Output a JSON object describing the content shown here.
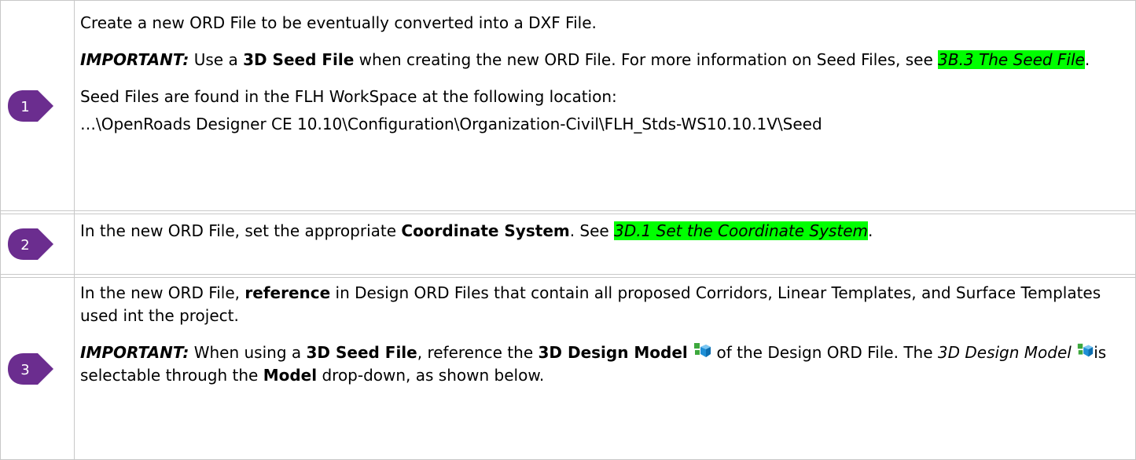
{
  "steps": [
    {
      "number": "1",
      "line1": "Create a new ORD File to be eventually converted into a DXF File.",
      "important_label": "IMPORTANT:",
      "important_pre": " Use a ",
      "important_bold": "3D Seed File",
      "important_mid": " when creating the new ORD File.  For more information on Seed Files, see ",
      "important_link": "3B.3 The Seed File",
      "important_post": ".",
      "location_intro": "Seed Files are found in the FLH WorkSpace at the following location:",
      "location_path": "…\\OpenRoads Designer CE 10.10\\Configuration\\Organization-Civil\\FLH_Stds-WS10.10.1V\\Seed"
    },
    {
      "number": "2",
      "pre": "In the new ORD File, set the appropriate ",
      "bold": "Coordinate System",
      "mid": ".  See ",
      "link": "3D.1 Set the Coordinate System",
      "post": "."
    },
    {
      "number": "3",
      "pre": "In the new ORD File, ",
      "bold": "reference",
      "post": " in Design ORD Files that contain all proposed Corridors, Linear Templates, and Surface Templates used int the project.",
      "important_label": "IMPORTANT:",
      "imp_a": "  When using a ",
      "imp_b": "3D Seed File",
      "imp_c": ", reference the ",
      "imp_d": "3D Design Model",
      "imp_e": " of the Design ORD File.  The ",
      "imp_f": "3D Design Model",
      "imp_g": "is selectable through the ",
      "imp_h": "Model",
      "imp_i": " drop-down, as shown below."
    }
  ],
  "colors": {
    "marker": "#6b2d8f",
    "highlight": "#00ff00",
    "border": "#c8c8c8"
  },
  "icons": {
    "marker": "step-marker-icon",
    "model": "3d-design-model-icon"
  }
}
